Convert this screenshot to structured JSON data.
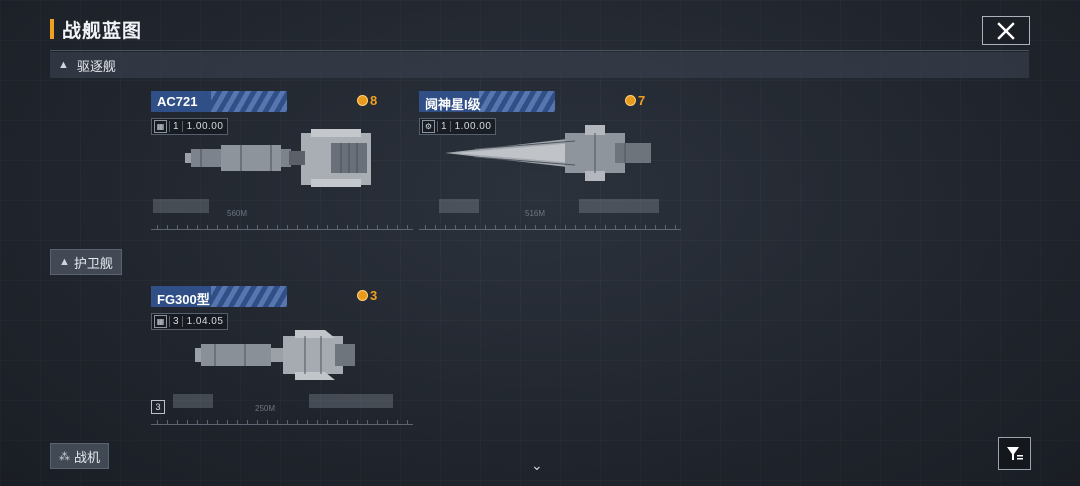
{
  "header": {
    "title": "战舰蓝图"
  },
  "categories": {
    "destroyer": {
      "label": "驱逐舰",
      "icon": "triangle-icon"
    },
    "frigate": {
      "label": "护卫舰",
      "icon": "triangle-icon"
    },
    "fighter": {
      "label": "战机",
      "icon": "triple-triangle-icon"
    }
  },
  "ships": [
    {
      "name": "AC721",
      "cost": "8",
      "level": "1",
      "version": "1.00.00",
      "length": "560M"
    },
    {
      "name": "阋神星I级",
      "cost": "7",
      "level": "1",
      "version": "1.00.00",
      "length": "516M"
    },
    {
      "name": "FG300型",
      "cost": "3",
      "level": "3",
      "version": "1.04.05",
      "length": "250M",
      "tier": "3"
    }
  ],
  "colors": {
    "accent": "#f0a020",
    "name_bar": "#2f4f86",
    "background": "#262b34"
  }
}
